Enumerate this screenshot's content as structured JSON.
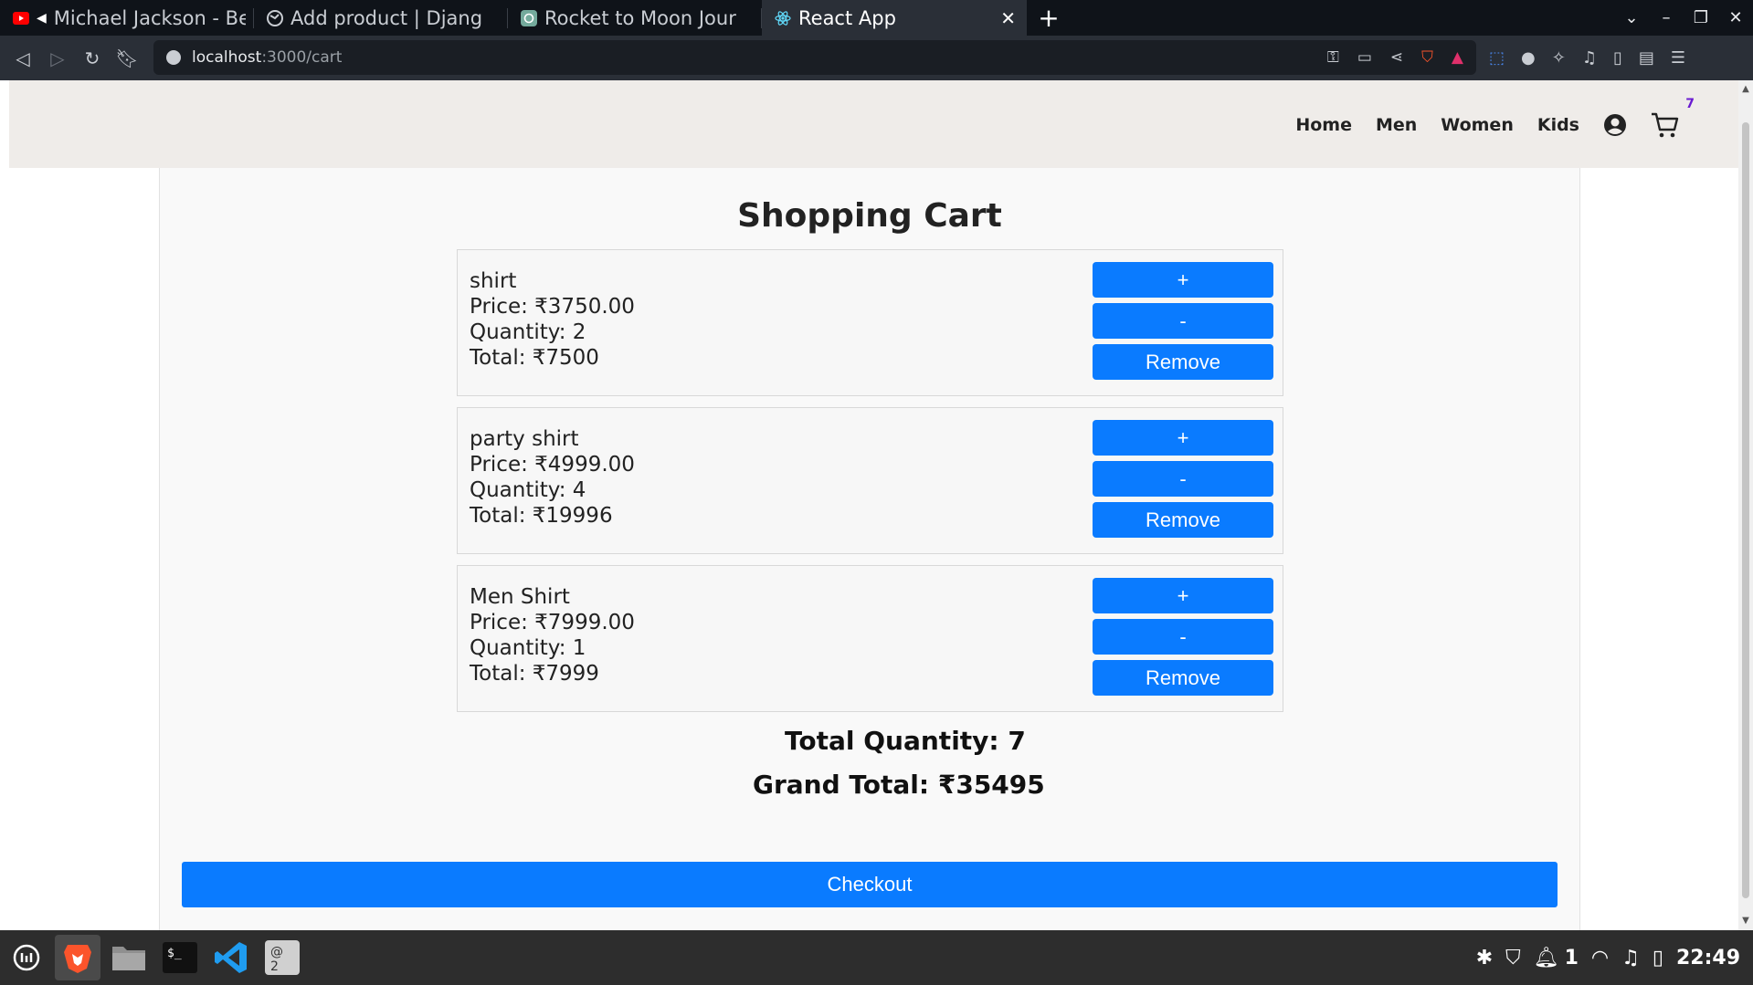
{
  "browser": {
    "tabs": [
      {
        "label": "Michael Jackson - Bea",
        "icon": "youtube-icon"
      },
      {
        "label": "Add product | Django si",
        "icon": "globe-icon"
      },
      {
        "label": "Rocket to Moon Journe",
        "icon": "openai-icon"
      },
      {
        "label": "React App",
        "icon": "react-icon",
        "active": true
      }
    ],
    "new_tab": "+",
    "url_host": "localhost",
    "url_rest": ":3000/cart"
  },
  "nav": {
    "links": [
      "Home",
      "Men",
      "Women",
      "Kids"
    ],
    "cart_count": "7"
  },
  "cart": {
    "title": "Shopping Cart",
    "items": [
      {
        "name": "shirt",
        "price": "Price: ₹3750.00",
        "quantity": "Quantity: 2",
        "total": "Total: ₹7500"
      },
      {
        "name": "party shirt",
        "price": "Price: ₹4999.00",
        "quantity": "Quantity: 4",
        "total": "Total: ₹19996"
      },
      {
        "name": "Men Shirt",
        "price": "Price: ₹7999.00",
        "quantity": "Quantity: 1",
        "total": "Total: ₹7999"
      }
    ],
    "buttons": {
      "plus": "+",
      "minus": "-",
      "remove": "Remove"
    },
    "total_quantity": "Total Quantity: 7",
    "grand_total": "Grand Total: ₹35495",
    "checkout": "Checkout"
  },
  "taskbar": {
    "notification_count": "1",
    "clock": "22:49"
  },
  "colors": {
    "primary_button": "#0a7bff",
    "navbar_bg": "#efece9",
    "cart_badge": "#6a1bd1"
  }
}
